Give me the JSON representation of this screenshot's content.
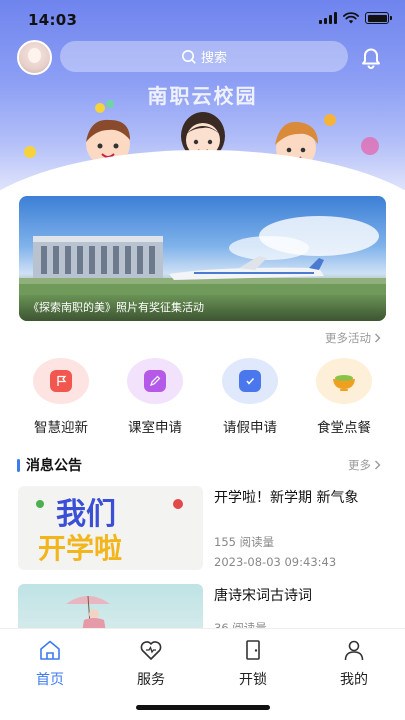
{
  "status_bar": {
    "time": "14:03"
  },
  "header": {
    "search_placeholder": "搜索",
    "hero_title": "南职云校园"
  },
  "banner": {
    "caption": "《探索南职的美》照片有奖征集活动",
    "more_label": "更多活动"
  },
  "shortcuts": [
    {
      "label": "智慧迎新",
      "icon": "flag-icon",
      "color": "#f2574f",
      "bg": "#fde4e2"
    },
    {
      "label": "课室申请",
      "icon": "edit-icon",
      "color": "#b459e8",
      "bg": "#f3e2fb"
    },
    {
      "label": "请假申请",
      "icon": "calendar-check-icon",
      "color": "#4a78ec",
      "bg": "#e0e8fb"
    },
    {
      "label": "食堂点餐",
      "icon": "bowl-icon",
      "color": "#f0a020",
      "bg": "#fdefd8"
    }
  ],
  "announcements": {
    "title": "消息公告",
    "more_label": "更多",
    "items": [
      {
        "title": "开学啦！新学期 新气象",
        "reads": "155 阅读量",
        "date": "2023-08-03 09:43:43",
        "thumb_text_1": "我们",
        "thumb_text_2": "开学啦"
      },
      {
        "title": "唐诗宋词古诗词",
        "reads": "36 阅读量",
        "date": ""
      }
    ]
  },
  "tabbar": {
    "active_color": "#3f7bf0",
    "tabs": [
      {
        "label": "首页",
        "icon": "home-icon",
        "active": true
      },
      {
        "label": "服务",
        "icon": "heart-service-icon",
        "active": false
      },
      {
        "label": "开锁",
        "icon": "door-icon",
        "active": false
      },
      {
        "label": "我的",
        "icon": "user-icon",
        "active": false
      }
    ]
  }
}
